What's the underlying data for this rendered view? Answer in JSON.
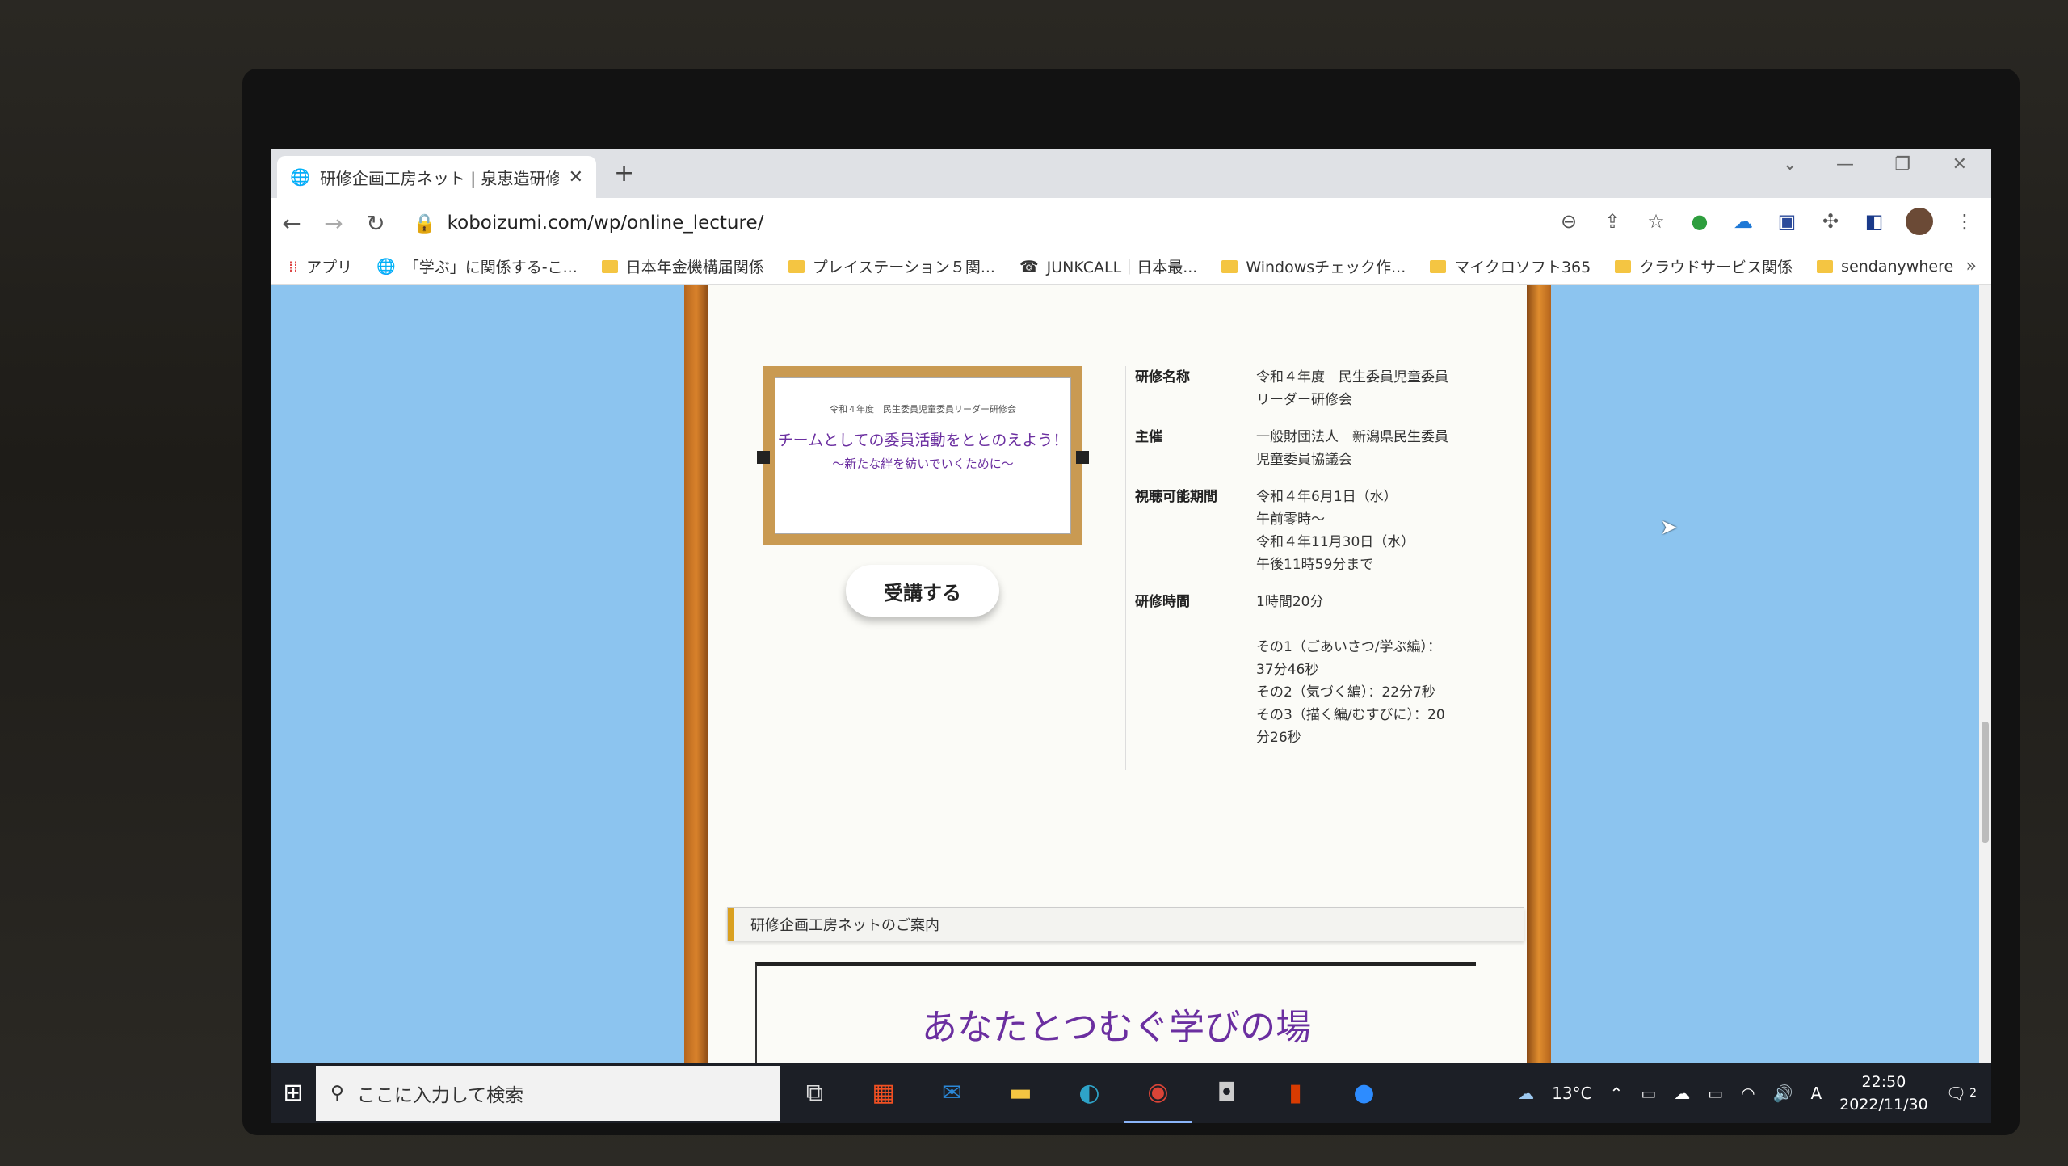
{
  "browser": {
    "tab_title": "研修企画工房ネット | 泉恵造研修...",
    "url": "koboizumi.com/wp/online_lecture/",
    "bookmarks": [
      "アプリ",
      "「学ぶ」に関係する‐こ...",
      "日本年金機構届関係",
      "プレイステーション５関...",
      "JUNKCALL｜日本最...",
      "Windowsチェック作...",
      "マイクロソフト365",
      "クラウドサービス関係",
      "sendanywhere"
    ],
    "bookmarks_more": "»"
  },
  "page": {
    "thumb_small": "令和４年度　民生委員児童委員リーダー研修会",
    "thumb_main": "チームとしての委員活動をととのえよう！",
    "thumb_sub": "～新たな絆を紡いでいくために～",
    "enroll_button": "受講する",
    "info": {
      "name_label": "研修名称",
      "name_lines": [
        "令和４年度　民生委員児童委員",
        "リーダー研修会"
      ],
      "host_label": "主催",
      "host_lines": [
        "一般財団法人　新潟県民生委員",
        "児童委員協議会"
      ],
      "period_label": "視聴可能期間",
      "period_lines": [
        "令和４年6月1日（水）",
        "午前零時～",
        "令和４年11月30日（水）",
        "午後11時59分まで"
      ],
      "time_label": "研修時間",
      "time_lines": [
        "1時間20分",
        "",
        "その1（ごあいさつ/学ぶ編）：",
        "37分46秒",
        "その2（気づく編）：22分7秒",
        "その3（描く編/むすびに）：20",
        "分26秒"
      ]
    },
    "section_title": "研修企画工房ネットのご案内",
    "lead": "あなたとつむぐ学びの場"
  },
  "taskbar": {
    "search_placeholder": "ここに入力して検索",
    "weather": "13°C",
    "ime": "A",
    "time": "22:50",
    "date": "2022/11/30",
    "notifications": "2"
  }
}
